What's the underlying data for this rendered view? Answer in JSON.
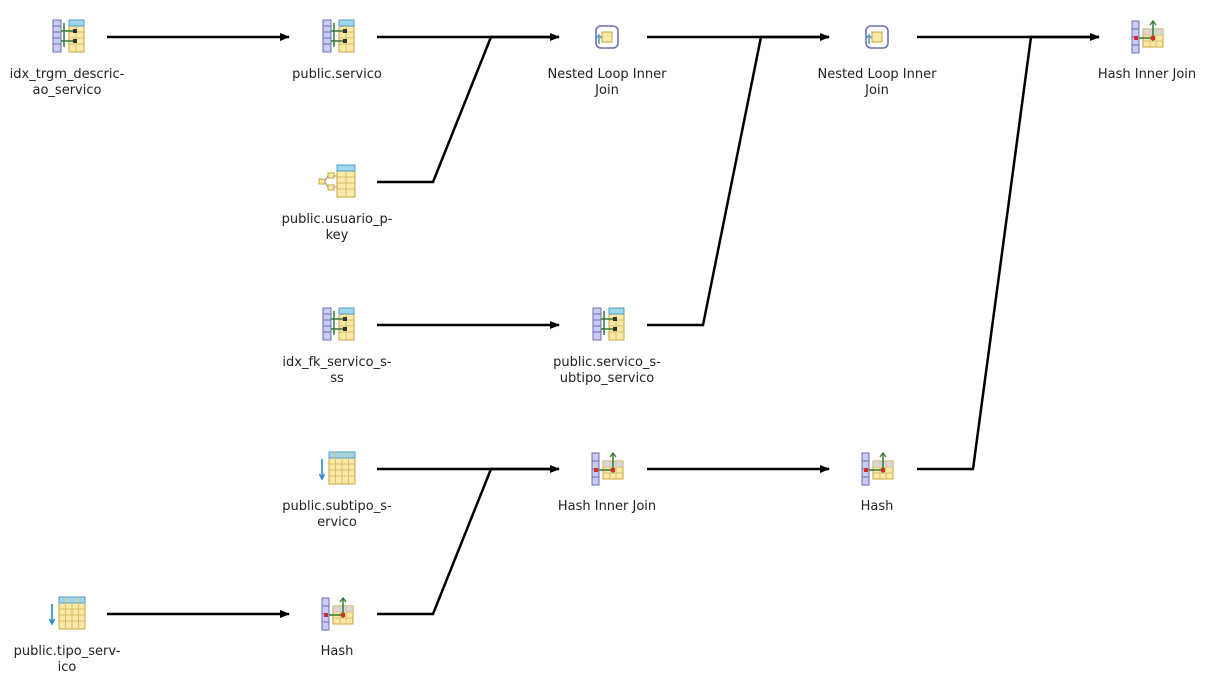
{
  "diagram": {
    "nodes": [
      {
        "id": "n1",
        "label": "idx_trgm_descric-\nao_servico",
        "icon": "index-scan-icon"
      },
      {
        "id": "n2",
        "label": "public.servico",
        "icon": "index-scan-icon"
      },
      {
        "id": "n3",
        "label": "Nested Loop Inner\nJoin",
        "icon": "nested-loop-icon"
      },
      {
        "id": "n4",
        "label": "Nested Loop Inner\nJoin",
        "icon": "nested-loop-icon"
      },
      {
        "id": "n5",
        "label": "Hash Inner Join",
        "icon": "hash-join-icon"
      },
      {
        "id": "n6",
        "label": "public.usuario_p-\nkey",
        "icon": "index-only-scan-icon"
      },
      {
        "id": "n7",
        "label": "idx_fk_servico_s-\nss",
        "icon": "index-scan-icon"
      },
      {
        "id": "n8",
        "label": "public.servico_s-\nubtipo_servico",
        "icon": "index-scan-icon"
      },
      {
        "id": "n9",
        "label": "public.subtipo_s-\nervico",
        "icon": "seq-scan-icon"
      },
      {
        "id": "n10",
        "label": "Hash Inner Join",
        "icon": "hash-join-icon"
      },
      {
        "id": "n11",
        "label": "Hash",
        "icon": "hash-join-icon"
      },
      {
        "id": "n12",
        "label": "public.tipo_serv-\nico",
        "icon": "seq-scan-icon"
      },
      {
        "id": "n13",
        "label": "Hash",
        "icon": "hash-join-icon"
      }
    ],
    "edges": [
      {
        "from": "n1",
        "to": "n2"
      },
      {
        "from": "n2",
        "to": "n3"
      },
      {
        "from": "n6",
        "to": "n3"
      },
      {
        "from": "n3",
        "to": "n4"
      },
      {
        "from": "n8",
        "to": "n4"
      },
      {
        "from": "n7",
        "to": "n8"
      },
      {
        "from": "n4",
        "to": "n5"
      },
      {
        "from": "n11",
        "to": "n5"
      },
      {
        "from": "n9",
        "to": "n10"
      },
      {
        "from": "n13",
        "to": "n10"
      },
      {
        "from": "n10",
        "to": "n11"
      },
      {
        "from": "n12",
        "to": "n13"
      }
    ]
  }
}
